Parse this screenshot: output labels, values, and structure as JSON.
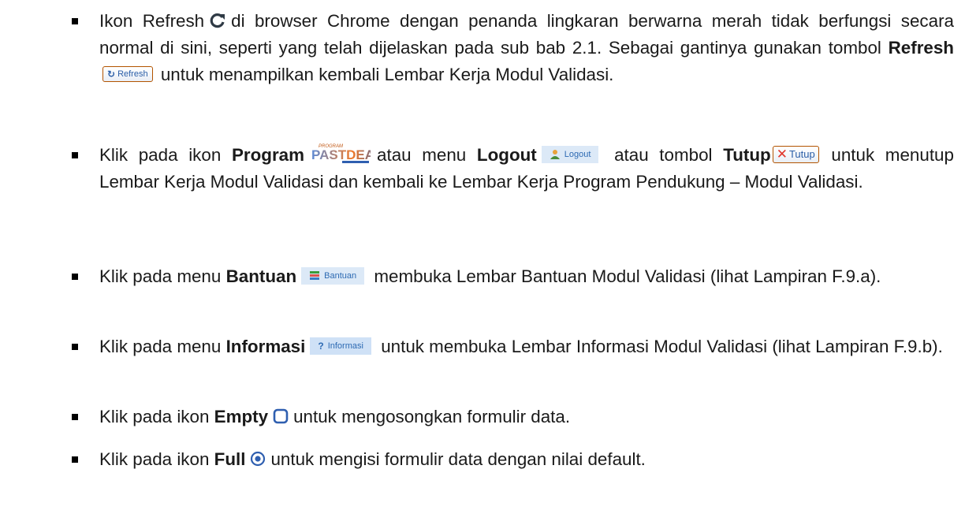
{
  "items": [
    {
      "p1": "Ikon Refresh",
      "p2": "di browser Chrome dengan penanda lingkaran berwarna merah tidak berfungsi secara normal di sini, seperti yang telah dijelaskan pada sub bab 2.1. Sebagai gantinya gunakan tombol",
      "bold1": "Refresh",
      "button_label": "Refresh",
      "p3": "untuk menampilkan kembali Lembar Kerja Modul Validasi."
    },
    {
      "p1": "Klik pada ikon",
      "bold1": "Program",
      "logo_small": "PROGRAM",
      "logo_text": "PASTDEAM",
      "p2": "atau menu",
      "bold2": "Logout",
      "logout_label": "Logout",
      "p3": "atau tombol",
      "bold3": "Tutup",
      "tutup_label": "Tutup",
      "p4": "untuk menutup Lembar Kerja Modul Validasi dan kembali ke Lembar Kerja Program Pendukung – Modul Validasi."
    },
    {
      "p1": "Klik pada menu",
      "bold1": "Bantuan",
      "menu_label": "Bantuan",
      "p2": "membuka Lembar Bantuan Modul Validasi (lihat Lampiran F.9.a)."
    },
    {
      "p1": "Klik pada menu",
      "bold1": "Informasi",
      "menu_label": "Informasi",
      "p2": "untuk membuka Lembar Informasi Modul Validasi (lihat Lampiran F.9.b)."
    },
    {
      "p1": "Klik pada ikon",
      "bold1": "Empty",
      "p2": "untuk mengosongkan formulir data."
    },
    {
      "p1": "Klik pada ikon",
      "bold1": "Full",
      "p2": "untuk mengisi formulir data dengan nilai default."
    }
  ],
  "icons": {
    "refresh": "refresh-icon",
    "empty": "empty-icon",
    "full": "radio-icon",
    "logout": "user-icon",
    "bantuan": "book-icon",
    "informasi": "question-icon",
    "tutup": "close-icon"
  },
  "colors": {
    "text": "#1a1a1a",
    "menu_bg": "#dce9f7",
    "menu_text": "#2d6ab3",
    "button_border": "#b35400",
    "close_red": "#e0362c",
    "icon_blue": "#2f5fb0"
  }
}
